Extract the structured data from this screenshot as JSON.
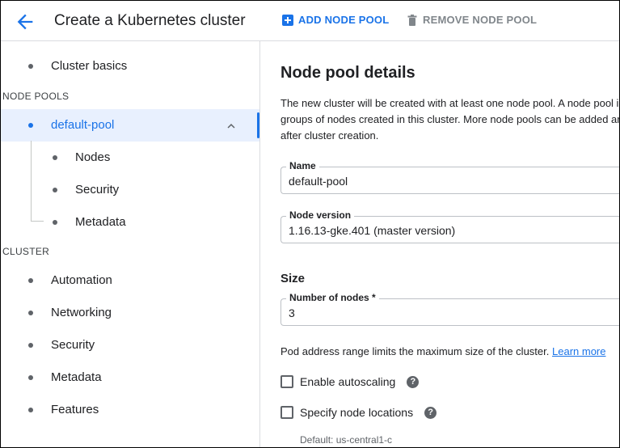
{
  "header": {
    "title": "Create a Kubernetes cluster",
    "add_node_pool": "ADD NODE POOL",
    "remove_node_pool": "REMOVE NODE POOL",
    "accent_color": "#1a73e8",
    "disabled_color": "#80868b"
  },
  "sidebar": {
    "cluster_basics": "Cluster basics",
    "node_pools_heading": "NODE POOLS",
    "default_pool": "default-pool",
    "pool_children": [
      "Nodes",
      "Security",
      "Metadata"
    ],
    "cluster_heading": "CLUSTER",
    "cluster_items": [
      "Automation",
      "Networking",
      "Security",
      "Metadata",
      "Features"
    ]
  },
  "main": {
    "title": "Node pool details",
    "description_lines": [
      "The new cluster will be created with at least one node pool. A node pool i",
      "groups of nodes created in this cluster. More node pools can be added ar",
      "after cluster creation."
    ],
    "name_label": "Name",
    "name_value": "default-pool",
    "version_label": "Node version",
    "version_value": "1.16.13-gke.401 (master version)",
    "size_title": "Size",
    "nodes_label": "Number of nodes *",
    "nodes_value": "3",
    "pod_hint": "Pod address range limits the maximum size of the cluster.",
    "learn_more": "Learn more",
    "autoscaling_label": "Enable autoscaling",
    "autoscaling_checked": false,
    "locations_label": "Specify node locations",
    "locations_checked": false,
    "help_glyph": "?",
    "default_location": "Default: us-central1-c"
  }
}
